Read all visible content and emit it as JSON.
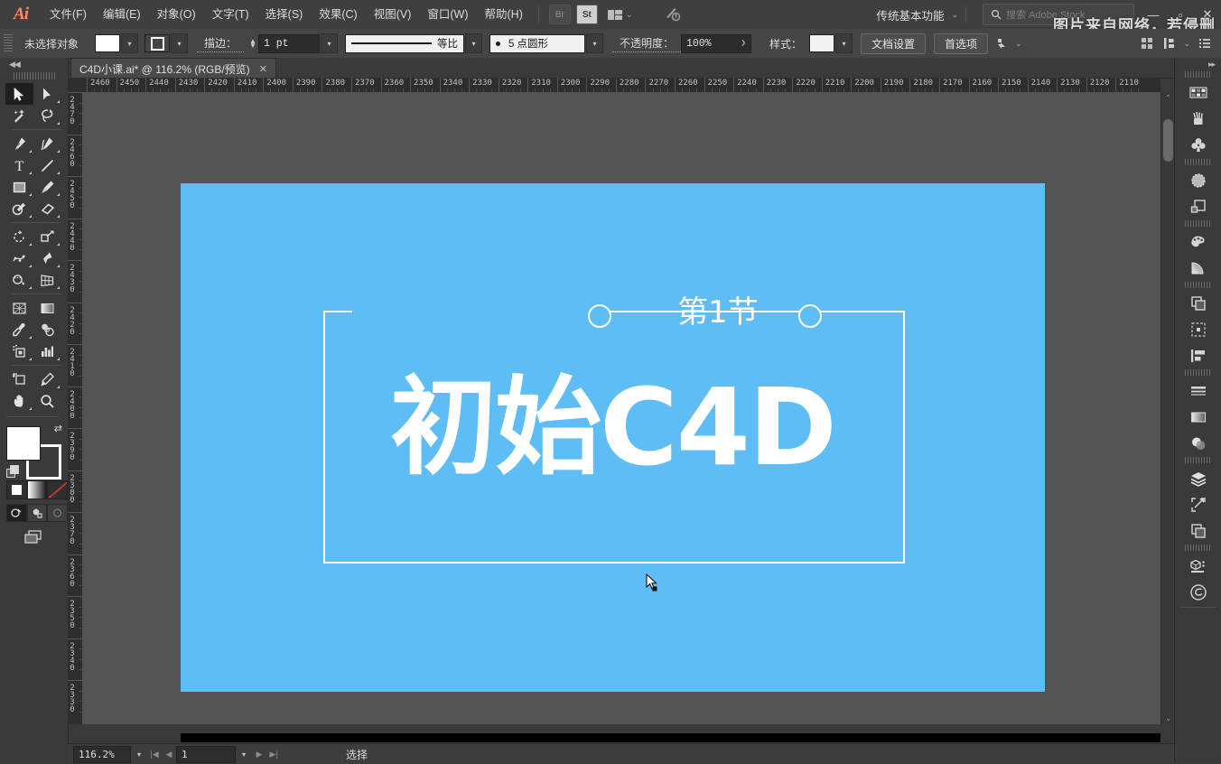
{
  "app": {
    "name": "Adobe Illustrator",
    "logo": "Ai"
  },
  "menubar": {
    "items": [
      {
        "label": "文件(F)",
        "name": "menu-file"
      },
      {
        "label": "编辑(E)",
        "name": "menu-edit"
      },
      {
        "label": "对象(O)",
        "name": "menu-object"
      },
      {
        "label": "文字(T)",
        "name": "menu-type"
      },
      {
        "label": "选择(S)",
        "name": "menu-select"
      },
      {
        "label": "效果(C)",
        "name": "menu-effect"
      },
      {
        "label": "视图(V)",
        "name": "menu-view"
      },
      {
        "label": "窗口(W)",
        "name": "menu-window"
      },
      {
        "label": "帮助(H)",
        "name": "menu-help"
      }
    ],
    "bridge_label": "Br",
    "stock_label": "St",
    "workspace": "传统基本功能",
    "search_placeholder": "搜索 Adobe Stock",
    "window_minimize": "—",
    "window_maximize": "▫",
    "window_close": "✕",
    "watermark": "图片来自网络，若侵删"
  },
  "controlbar": {
    "selection_status": "未选择对象",
    "stroke_label": "描边：",
    "stroke_width": "1 pt",
    "stroke_profile": "等比",
    "brush_def": "5 点圆形",
    "opacity_label": "不透明度：",
    "opacity_value": "100%",
    "style_label": "样式：",
    "document_setup": "文档设置",
    "preferences": "首选项"
  },
  "tabbar": {
    "document_tab": "C4D小课.ai* @ 116.2% (RGB/预览)",
    "close_glyph": "✕"
  },
  "toolbar": {
    "collapse_glyph": "◀◀",
    "tools": [
      {
        "name": "selection-tool",
        "active": true
      },
      {
        "name": "direct-selection-tool",
        "active": false
      },
      {
        "name": "magic-wand-tool",
        "active": false
      },
      {
        "name": "lasso-tool",
        "active": false
      },
      {
        "name": "pen-tool",
        "active": false
      },
      {
        "name": "curvature-tool",
        "active": false
      },
      {
        "name": "type-tool",
        "active": false
      },
      {
        "name": "line-segment-tool",
        "active": false
      },
      {
        "name": "rectangle-tool",
        "active": false
      },
      {
        "name": "paintbrush-tool",
        "active": false
      },
      {
        "name": "shaper-tool",
        "active": false
      },
      {
        "name": "eraser-tool",
        "active": false
      },
      {
        "name": "rotate-tool",
        "active": false
      },
      {
        "name": "scale-tool",
        "active": false
      },
      {
        "name": "width-tool",
        "active": false
      },
      {
        "name": "free-transform-tool",
        "active": false
      },
      {
        "name": "shape-builder-tool",
        "active": false
      },
      {
        "name": "perspective-grid-tool",
        "active": false
      },
      {
        "name": "mesh-tool",
        "active": false
      },
      {
        "name": "gradient-tool",
        "active": false
      },
      {
        "name": "eyedropper-tool",
        "active": false
      },
      {
        "name": "blend-tool",
        "active": false
      },
      {
        "name": "symbol-sprayer-tool",
        "active": false
      },
      {
        "name": "column-graph-tool",
        "active": false
      },
      {
        "name": "artboard-tool",
        "active": false
      },
      {
        "name": "slice-tool",
        "active": false
      },
      {
        "name": "hand-tool",
        "active": false
      },
      {
        "name": "zoom-tool",
        "active": false
      }
    ],
    "fill_color": "#ffffff",
    "stroke_color": "#ffffff"
  },
  "rulers": {
    "horizontal_labels": [
      "2460",
      "2450",
      "2440",
      "2430",
      "2420",
      "2410",
      "2400",
      "2390",
      "2380",
      "2370",
      "2360",
      "2350",
      "2340",
      "2330",
      "2320",
      "2310",
      "2300",
      "2290",
      "2280",
      "2270",
      "2260",
      "2250",
      "2240",
      "2230",
      "2220",
      "2210",
      "2200",
      "2190",
      "2180",
      "2170",
      "2160",
      "2150",
      "2140",
      "2130",
      "2120",
      "2110"
    ],
    "vertical_labels": [
      "2470",
      "2460",
      "2450",
      "2440",
      "2430",
      "2420",
      "2410",
      "2400",
      "2390",
      "2380",
      "2370",
      "2360",
      "2350",
      "2340",
      "2330"
    ]
  },
  "artwork": {
    "background_color": "#5FBDF5",
    "text_color": "#ffffff",
    "section_label": "第1节",
    "headline": "初始C4D"
  },
  "statusbar": {
    "zoom_level": "116.2%",
    "page_number": "1",
    "status_text": "选择",
    "first_glyph": "|◀",
    "prev_glyph": "◀",
    "next_glyph": "▶",
    "last_glyph": "▶|"
  },
  "rightdock": {
    "collapse_glyph": "▸▸",
    "panels": [
      {
        "name": "panel-color-guide"
      },
      {
        "name": "panel-brushes"
      },
      {
        "name": "panel-symbols"
      },
      {
        "name": "panel-appearance"
      },
      {
        "name": "panel-graphic-styles"
      },
      {
        "name": "panel-swatches"
      },
      {
        "name": "panel-gradient-shape"
      },
      {
        "name": "panel-layers"
      },
      {
        "name": "panel-transform"
      },
      {
        "name": "panel-align"
      },
      {
        "name": "panel-stroke"
      },
      {
        "name": "panel-gradient"
      },
      {
        "name": "panel-transparency"
      },
      {
        "name": "panel-layers-stack"
      },
      {
        "name": "panel-artboards"
      },
      {
        "name": "panel-pathfinder"
      },
      {
        "name": "panel-asset-export"
      },
      {
        "name": "panel-creative-cloud"
      }
    ]
  }
}
